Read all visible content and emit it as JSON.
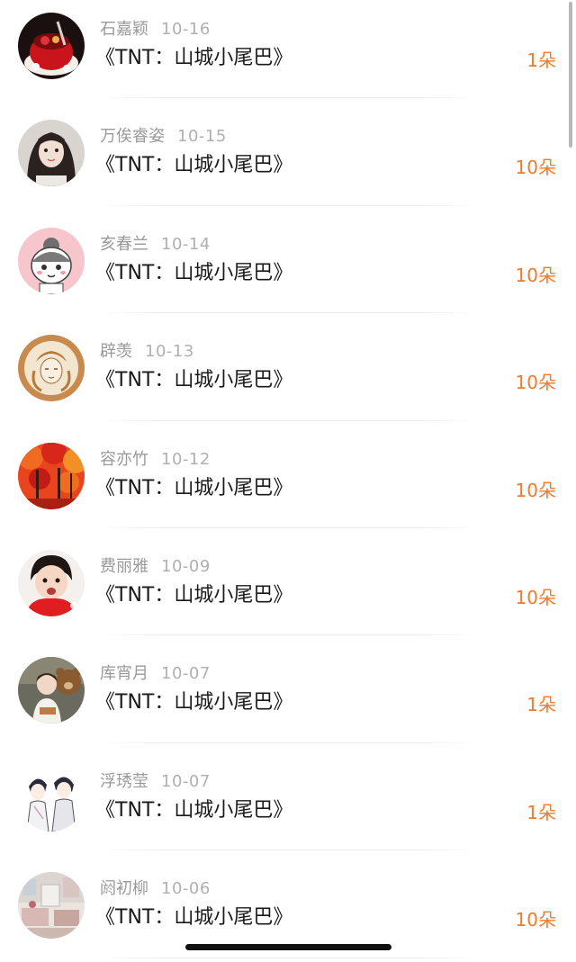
{
  "items": [
    {
      "name": "石嘉颖",
      "date": "10-16",
      "title": "《TNT：山城小尾巴》",
      "amount": "1朵",
      "avatar": "red-dessert-photo"
    },
    {
      "name": "万俟睿姿",
      "date": "10-15",
      "title": "《TNT：山城小尾巴》",
      "amount": "10朵",
      "avatar": "girl-portrait-photo"
    },
    {
      "name": "亥春兰",
      "date": "10-14",
      "title": "《TNT：山城小尾巴》",
      "amount": "10朵",
      "avatar": "cartoon-girl-drawing"
    },
    {
      "name": "辟羡",
      "date": "10-13",
      "title": "《TNT：山城小尾巴》",
      "amount": "10朵",
      "avatar": "latte-art-photo"
    },
    {
      "name": "容亦竹",
      "date": "10-12",
      "title": "《TNT：山城小尾巴》",
      "amount": "10朵",
      "avatar": "autumn-forest-photo"
    },
    {
      "name": "费丽雅",
      "date": "10-09",
      "title": "《TNT：山城小尾巴》",
      "amount": "10朵",
      "avatar": "child-red-shirt-photo"
    },
    {
      "name": "库宵月",
      "date": "10-07",
      "title": "《TNT：山城小尾巴》",
      "amount": "1朵",
      "avatar": "girl-with-bear-photo"
    },
    {
      "name": "浮琇莹",
      "date": "10-07",
      "title": "《TNT：山城小尾巴》",
      "amount": "1朵",
      "avatar": "anime-couple-drawing"
    },
    {
      "name": "阏初柳",
      "date": "10-06",
      "title": "《TNT：山城小尾巴》",
      "amount": "10朵",
      "avatar": "room-interior-photo"
    }
  ],
  "colors": {
    "amount": "#f07a2d",
    "name": "#9a9a9a",
    "title": "#1a1a1a"
  }
}
